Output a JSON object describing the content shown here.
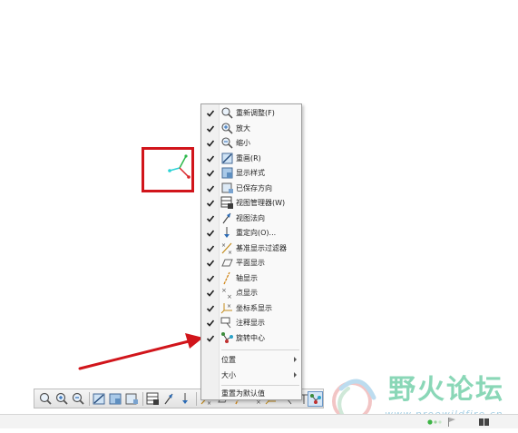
{
  "menu": {
    "items": [
      {
        "label": "重新调整(F)",
        "checked": true,
        "icon": "refit-icon"
      },
      {
        "label": "放大",
        "checked": true,
        "icon": "zoom-in-icon"
      },
      {
        "label": "缩小",
        "checked": true,
        "icon": "zoom-out-icon"
      },
      {
        "label": "重画(R)",
        "checked": true,
        "icon": "repaint-icon"
      },
      {
        "label": "显示样式",
        "checked": true,
        "icon": "display-style-icon"
      },
      {
        "label": "已保存方向",
        "checked": true,
        "icon": "saved-orientation-icon"
      },
      {
        "label": "视图管理器(W)",
        "checked": true,
        "icon": "view-manager-icon"
      },
      {
        "label": "视图法向",
        "checked": true,
        "icon": "view-normal-icon"
      },
      {
        "label": "重定向(O)...",
        "checked": true,
        "icon": "reorient-icon"
      },
      {
        "label": "基准显示过滤器",
        "checked": true,
        "icon": "datum-filter-icon"
      },
      {
        "label": "平面显示",
        "checked": true,
        "icon": "plane-display-icon"
      },
      {
        "label": "轴显示",
        "checked": true,
        "icon": "axis-display-icon"
      },
      {
        "label": "点显示",
        "checked": true,
        "icon": "point-display-icon"
      },
      {
        "label": "坐标系显示",
        "checked": true,
        "icon": "csys-display-icon"
      },
      {
        "label": "注释显示",
        "checked": true,
        "icon": "annotation-display-icon"
      },
      {
        "label": "旋转中心",
        "checked": true,
        "icon": "spin-center-icon"
      }
    ],
    "submenus": [
      {
        "label": "位置"
      },
      {
        "label": "大小"
      }
    ],
    "reset_label": "重置为默认值"
  },
  "watermark": {
    "text": "野火论坛",
    "url": "www.proewildfire.cn"
  },
  "colors": {
    "highlight_red": "#d1151b",
    "axis_green": "#2db84b",
    "axis_cyan": "#2ad3d6",
    "axis_red": "#d9262a"
  }
}
